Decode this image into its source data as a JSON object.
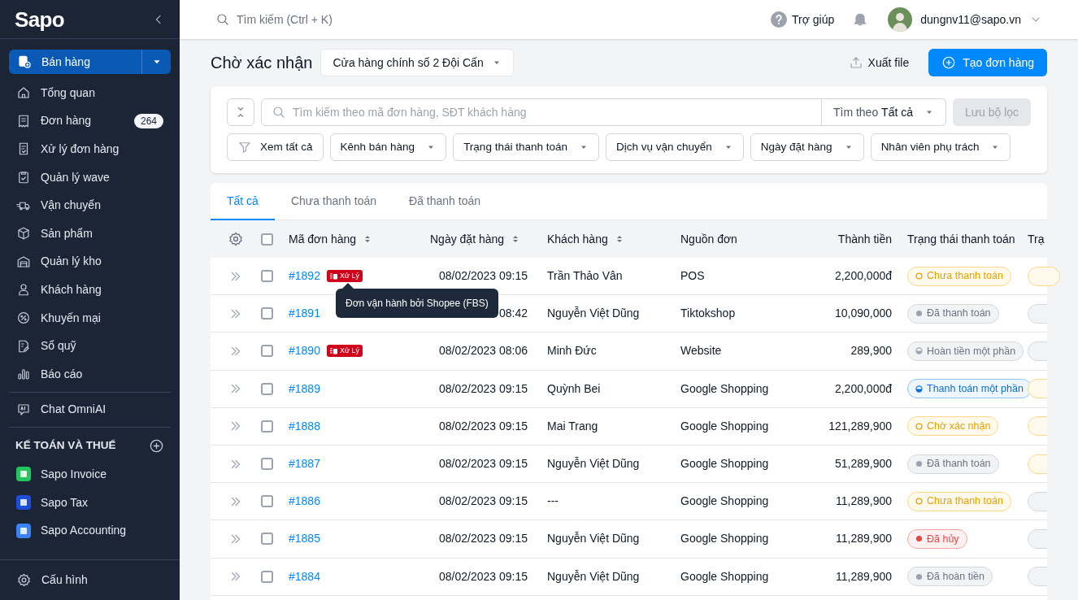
{
  "sidebar": {
    "logo": "Sapo",
    "primary": {
      "label": "Bán hàng"
    },
    "items": [
      {
        "label": "Tổng quan"
      },
      {
        "label": "Đơn hàng",
        "badge": "264"
      },
      {
        "label": "Xử lý đơn hàng"
      },
      {
        "label": "Quản lý wave"
      },
      {
        "label": "Vận chuyển"
      },
      {
        "label": "Sản phẩm"
      },
      {
        "label": "Quản lý kho"
      },
      {
        "label": "Khách hàng"
      },
      {
        "label": "Khuyến mại"
      },
      {
        "label": "Sổ quỹ"
      },
      {
        "label": "Báo cáo"
      }
    ],
    "chat": {
      "label": "Chat OmniAI"
    },
    "section": {
      "title": "KẾ TOÁN VÀ THUẾ"
    },
    "apps": [
      {
        "label": "Sapo Invoice",
        "color": "#22c55e"
      },
      {
        "label": "Sapo Tax",
        "color": "#1d4ed8"
      },
      {
        "label": "Sapo Accounting",
        "color": "#3b82f6"
      }
    ],
    "settings": {
      "label": "Cấu hình"
    }
  },
  "topbar": {
    "search": {
      "placeholder": "Tìm kiếm (Ctrl + K)"
    },
    "help": "Trợ giúp",
    "user": "dungnv11@sapo.vn"
  },
  "page": {
    "title": "Chờ xác nhận",
    "store": "Cửa hàng chính số 2 Đội Cấn",
    "export": "Xuất file",
    "create": "Tạo đơn hàng"
  },
  "filters": {
    "search": {
      "placeholder": "Tìm kiếm theo mã đơn hàng, SĐT khách hàng"
    },
    "search_by": {
      "label": "Tìm theo",
      "value": "Tất cả"
    },
    "save": {
      "label": "Lưu bộ lọc",
      "disabled": true
    },
    "view_all": "Xem tất cả",
    "dropdowns": [
      "Kênh bán hàng",
      "Trạng thái thanh toán",
      "Dịch vụ vận chuyển",
      "Ngày đặt hàng",
      "Nhân viên phụ trách"
    ]
  },
  "tabs": [
    {
      "label": "Tất cả",
      "selected": true
    },
    {
      "label": "Chưa thanh toán",
      "selected": false
    },
    {
      "label": "Đã thanh toán",
      "selected": false
    }
  ],
  "table": {
    "all_checked": false,
    "columns": [
      "Mã đơn hàng",
      "Ngày đặt hàng",
      "Khách hàng",
      "Nguồn đơn",
      "Thành tiền",
      "Trạng thái thanh toán",
      "Trạ"
    ],
    "rows": [
      {
        "checked": false,
        "code": "#1892",
        "tag": "Xử Lý",
        "date": "08/02/2023 09:15",
        "customer": "Trần Thảo Vân",
        "source": "POS",
        "total": "2,200,000đ",
        "status": {
          "label": "Chưa thanh toán",
          "kind": "unpaid"
        },
        "column_7": {
          "kind": "pending"
        }
      },
      {
        "checked": false,
        "code": "#1891",
        "date": "08:42",
        "customer": "Nguyễn Việt Dũng",
        "source": "Tiktokshop",
        "total": "10,090,000",
        "status": {
          "label": "Đã thanh toán",
          "kind": "paid"
        },
        "column_7": {
          "kind": "done"
        }
      },
      {
        "checked": false,
        "code": "#1890",
        "tag": "Xử Lý",
        "date": "08/02/2023 08:06",
        "customer": "Minh Đức",
        "source": "Website",
        "total": "289,900",
        "status": {
          "label": "Hoàn tiền một phần",
          "kind": "partial_refund"
        },
        "column_7": {
          "kind": "done"
        }
      },
      {
        "checked": false,
        "code": "#1889",
        "date": "08/02/2023 09:15",
        "customer": "Quỳnh Bei",
        "source": "Google Shopping",
        "total": "2,200,000đ",
        "status": {
          "label": "Thanh toán một phần",
          "kind": "partial"
        },
        "column_7": {
          "kind": "pending"
        }
      },
      {
        "checked": false,
        "code": "#1888",
        "date": "08/02/2023 09:15",
        "customer": "Mai Trang",
        "source": "Google Shopping",
        "total": "121,289,900",
        "status": {
          "label": "Chờ xác nhận",
          "kind": "unpaid"
        },
        "column_7": {
          "kind": "pending"
        }
      },
      {
        "checked": false,
        "code": "#1887",
        "date": "08/02/2023 09:15",
        "customer": "Nguyễn Việt Dũng",
        "source": "Google Shopping",
        "total": "51,289,900",
        "status": {
          "label": "Đã thanh toán",
          "kind": "paid"
        },
        "column_7": {
          "kind": "pending"
        }
      },
      {
        "checked": false,
        "code": "#1886",
        "date": "08/02/2023 09:15",
        "customer": "---",
        "source": "Google Shopping",
        "total": "11,289,900",
        "status": {
          "label": "Chưa thanh toán",
          "kind": "unpaid"
        },
        "column_7": {
          "kind": "done"
        }
      },
      {
        "checked": false,
        "code": "#1885",
        "date": "08/02/2023 09:15",
        "customer": "Nguyễn Việt Dũng",
        "source": "Google Shopping",
        "total": "11,289,900",
        "status": {
          "label": "Đã hủy",
          "kind": "cancelled"
        },
        "column_7": {
          "kind": "done"
        }
      },
      {
        "checked": false,
        "code": "#1884",
        "date": "08/02/2023 09:15",
        "customer": "Nguyễn Việt Dũng",
        "source": "Google Shopping",
        "total": "11,289,900",
        "status": {
          "label": "Đã hoàn tiền",
          "kind": "paid"
        },
        "column_7": {
          "kind": "done"
        }
      }
    ]
  },
  "tooltip": {
    "text": "Đơn vận hành bởi Shopee (FBS)"
  }
}
